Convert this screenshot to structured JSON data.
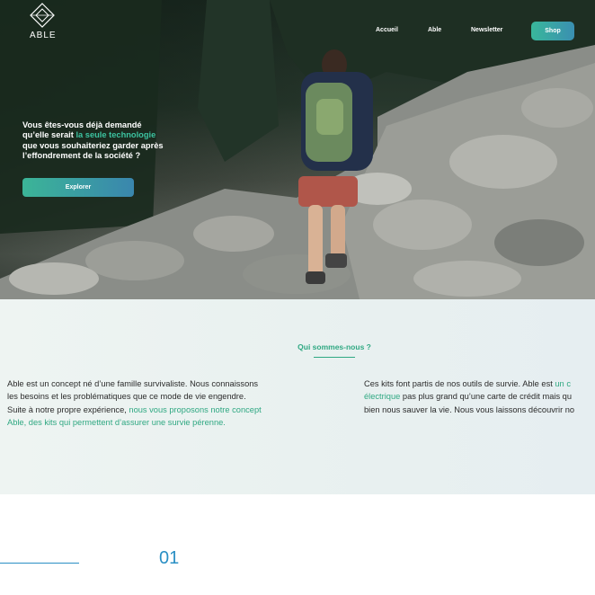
{
  "brand": {
    "name": "ABLE"
  },
  "nav": {
    "links": [
      "Accueil",
      "Able",
      "Newsletter"
    ],
    "shop_label": "Shop"
  },
  "hero": {
    "line1": "Vous êtes-vous déjà demandé",
    "line2_pre": "qu’elle serait ",
    "line2_highlight": "la seule technologie",
    "line3": "que vous souhaiteriez garder après",
    "line4": "l’effondrement de la société ?",
    "cta_label": "Explorer"
  },
  "about": {
    "title": "Qui sommes-nous ?",
    "left": {
      "line1": "Able est un concept né d’une famille survivaliste. Nous connaissons",
      "line2": "les besoins et les problématiques que ce mode de vie engendre.",
      "line3_pre": "Suite à notre propre expérience, ",
      "line3_accent": "nous vous proposons notre concept",
      "line4_accent": "Able, des kits qui permettent d’assurer une survie pérenne."
    },
    "right": {
      "line1_pre": "Ces kits font partis de nos outils de survie. Able est ",
      "line1_accent": "un c",
      "line2_accent": "électrique",
      "line2_post": " pas plus grand qu’une carte de crédit mais qu",
      "line3": "bien nous sauver la vie. Nous vous laissons découvrir no"
    }
  },
  "section": {
    "number": "01"
  },
  "colors": {
    "accent_green": "#2fa882",
    "accent_blue": "#2a8fc4"
  }
}
